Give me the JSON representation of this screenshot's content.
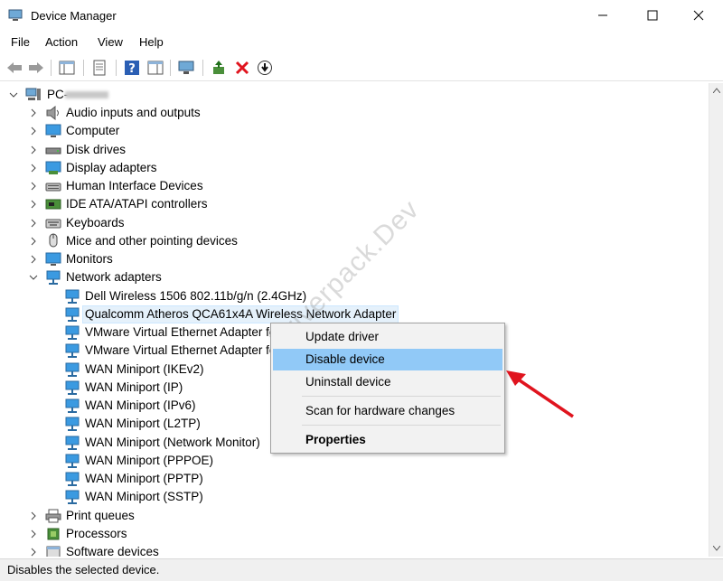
{
  "window": {
    "title": "Device Manager"
  },
  "menu": [
    "File",
    "Action",
    "View",
    "Help"
  ],
  "tree": {
    "root": "PC-",
    "categories": [
      {
        "label": "Audio inputs and outputs",
        "icon": "speaker-icon"
      },
      {
        "label": "Computer",
        "icon": "monitor-icon"
      },
      {
        "label": "Disk drives",
        "icon": "disk-drive-icon"
      },
      {
        "label": "Display adapters",
        "icon": "display-adapter-icon"
      },
      {
        "label": "Human Interface Devices",
        "icon": "hid-icon"
      },
      {
        "label": "IDE ATA/ATAPI controllers",
        "icon": "ide-controller-icon"
      },
      {
        "label": "Keyboards",
        "icon": "keyboard-icon"
      },
      {
        "label": "Mice and other pointing devices",
        "icon": "mouse-icon"
      },
      {
        "label": "Monitors",
        "icon": "monitor-icon"
      },
      {
        "label": "Network adapters",
        "icon": "network-adapter-icon",
        "expanded": true
      }
    ],
    "network_adapters": [
      "Dell Wireless 1506 802.11b/g/n (2.4GHz)",
      "Qualcomm Atheros QCA61x4A Wireless Network Adapter",
      "VMware Virtual Ethernet Adapter fo",
      "VMware Virtual Ethernet Adapter fo",
      "WAN Miniport (IKEv2)",
      "WAN Miniport (IP)",
      "WAN Miniport (IPv6)",
      "WAN Miniport (L2TP)",
      "WAN Miniport (Network Monitor)",
      "WAN Miniport (PPPOE)",
      "WAN Miniport (PPTP)",
      "WAN Miniport (SSTP)"
    ],
    "categories_after": [
      {
        "label": "Print queues",
        "icon": "printer-icon"
      },
      {
        "label": "Processors",
        "icon": "processor-icon"
      },
      {
        "label": "Software devices",
        "icon": "software-device-icon"
      }
    ]
  },
  "context_menu": {
    "update_driver": "Update driver",
    "disable_device": "Disable device",
    "uninstall_device": "Uninstall device",
    "scan": "Scan for hardware changes",
    "properties": "Properties"
  },
  "status": "Disables the selected device.",
  "watermark": "Driverpack.Dev",
  "colors": {
    "selection": "#e5f1fb",
    "menu_hover": "#91c9f7",
    "annotation_arrow": "#e0141e"
  }
}
